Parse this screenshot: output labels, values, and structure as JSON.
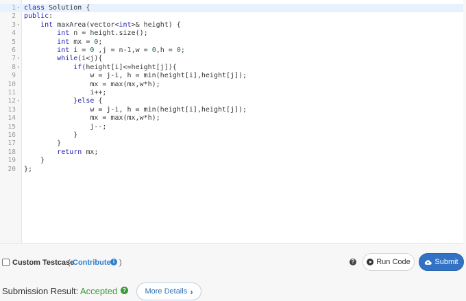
{
  "editor": {
    "active_line": 1,
    "lines": [
      "class Solution {",
      "public:",
      "    int maxArea(vector<int>& height) {",
      "        int n = height.size();",
      "        int mx = 0;",
      "        int i = 0 ,j = n-1,w = 0,h = 0;",
      "        while(i<j){",
      "            if(height[i]<=height[j]){",
      "                w = j-i, h = min(height[i],height[j]);",
      "                mx = max(mx,w*h);",
      "                i++;",
      "            }else {",
      "                w = j-i, h = min(height[i],height[j]);",
      "                mx = max(mx,w*h);",
      "                j--;",
      "            }",
      "        }",
      "        return mx;",
      "    }",
      "};"
    ],
    "fold_lines": [
      1,
      3,
      7,
      8,
      12
    ],
    "fold_marker": "▾"
  },
  "testcase": {
    "label": "Custom Testcase",
    "open_paren": "(",
    "contribute": "Contribute",
    "info_glyph": "i",
    "close_paren": ")"
  },
  "toolbar": {
    "help_glyph": "?",
    "run_label": "Run Code",
    "submit_label": "Submit"
  },
  "result": {
    "label": "Submission Result:",
    "status": "Accepted",
    "status_glyph": "?",
    "more_label": "More Details",
    "more_chevron": "›"
  },
  "colors": {
    "accent_blue": "#3172c4",
    "link_blue": "#2d7ed0",
    "accepted_green": "#3a9a3a",
    "active_line_bg": "#e8f2ff"
  }
}
